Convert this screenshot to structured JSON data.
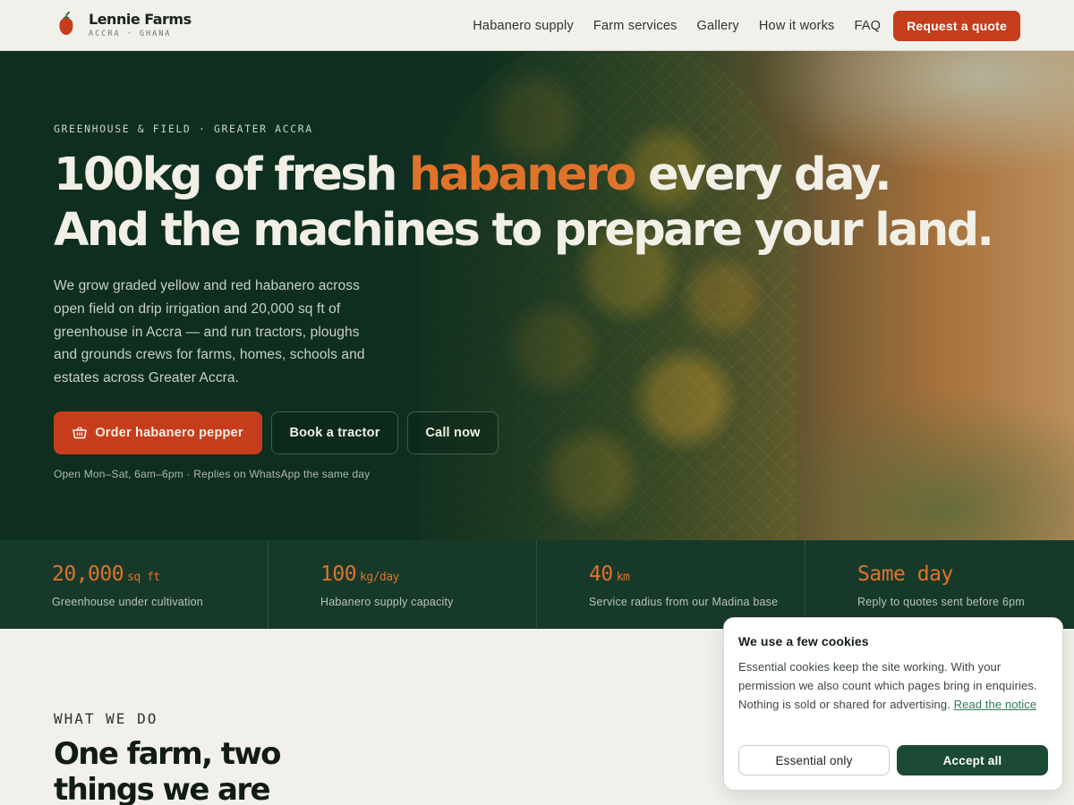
{
  "brand": {
    "name": "Lennie Farms",
    "tagline": "ACCRA · GHANA"
  },
  "nav": {
    "items": [
      "Habanero supply",
      "Farm services",
      "Gallery",
      "How it works",
      "FAQ"
    ],
    "cta": "Request a quote"
  },
  "hero": {
    "eyebrow": "GREENHOUSE & FIELD · GREATER ACCRA",
    "headline_pre": "100kg of fresh ",
    "headline_accent": "habanero",
    "headline_post": " every day.",
    "headline_line2": "And the machines to prepare your land.",
    "lede": "We grow graded yellow and red habanero across open field on drip irrigation and 20,000 sq ft of greenhouse in Accra — and run tractors, ploughs and grounds crews for farms, homes, schools and estates across Greater Accra.",
    "primary_cta": "Order habanero pepper",
    "secondary_cta": "Book a tractor",
    "tertiary_cta": "Call now",
    "hours": "Open Mon–Sat, 6am–6pm · Replies on WhatsApp the same day"
  },
  "stats": [
    {
      "value": "20,000",
      "unit": "sq ft",
      "label": "Greenhouse under cultivation"
    },
    {
      "value": "100",
      "unit": "kg/day",
      "label": "Habanero supply capacity"
    },
    {
      "value": "40",
      "unit": "km",
      "label": "Service radius from our Madina base"
    },
    {
      "value": "Same day",
      "unit": "",
      "label": "Reply to quotes sent before 6pm"
    }
  ],
  "what_we_do": {
    "eyebrow": "WHAT WE DO",
    "title": "One farm, two things we are known for."
  },
  "cookie": {
    "title": "We use a few cookies",
    "body": "Essential cookies keep the site working. With your permission we also count which pages bring in enquiries. Nothing is sold or shared for advertising. ",
    "link": "Read the notice",
    "essential_btn": "Essential only",
    "accept_btn": "Accept all"
  },
  "colors": {
    "accent": "#c63d1c",
    "highlight": "#e0732b",
    "dark_green": "#0f3020",
    "stats_green": "#17392a",
    "cream": "#f1f0ea"
  },
  "icons": {
    "logo": "pepper-icon",
    "cart": "basket-icon"
  }
}
